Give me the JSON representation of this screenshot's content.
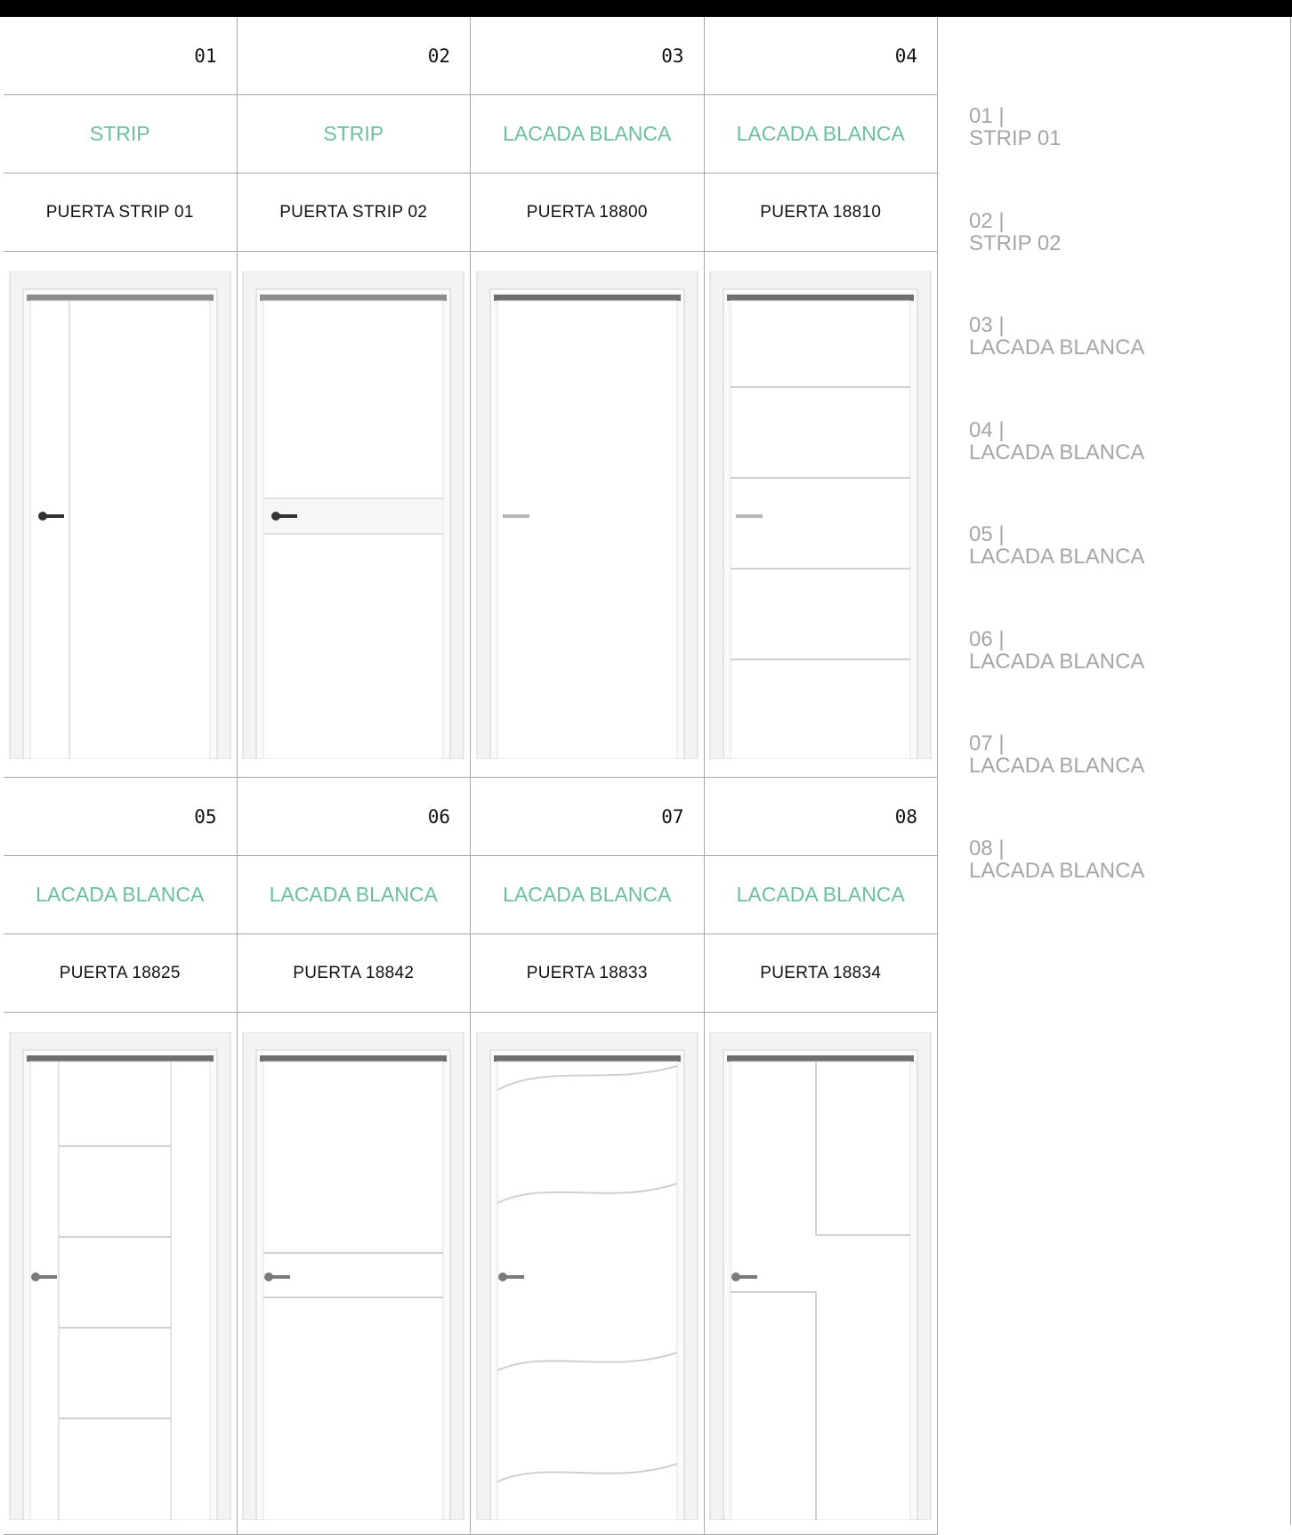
{
  "doors": [
    {
      "number": "01",
      "category": "STRIP",
      "name": "PUERTA STRIP 01",
      "icon": "door-strip-vertical-icon"
    },
    {
      "number": "02",
      "category": "STRIP",
      "name": "PUERTA STRIP 02",
      "icon": "door-strip-horizontal-icon"
    },
    {
      "number": "03",
      "category": "LACADA BLANCA",
      "name": "PUERTA 18800",
      "icon": "door-plain-icon"
    },
    {
      "number": "04",
      "category": "LACADA BLANCA",
      "name": "PUERTA 18810",
      "icon": "door-four-grooves-icon"
    },
    {
      "number": "05",
      "category": "LACADA BLANCA",
      "name": "PUERTA 18825",
      "icon": "door-ladder-grooves-icon"
    },
    {
      "number": "06",
      "category": "LACADA BLANCA",
      "name": "PUERTA 18842",
      "icon": "door-two-grooves-icon"
    },
    {
      "number": "07",
      "category": "LACADA BLANCA",
      "name": "PUERTA 18833",
      "icon": "door-wave-grooves-icon"
    },
    {
      "number": "08",
      "category": "LACADA BLANCA",
      "name": "PUERTA 18834",
      "icon": "door-offset-panels-icon"
    }
  ],
  "sidebar": [
    {
      "number": "01 |",
      "label": "STRIP 01"
    },
    {
      "number": "02 |",
      "label": "STRIP 02"
    },
    {
      "number": "03 |",
      "label": "LACADA BLANCA"
    },
    {
      "number": "04 |",
      "label": "LACADA BLANCA"
    },
    {
      "number": "05 |",
      "label": "LACADA BLANCA"
    },
    {
      "number": "06 |",
      "label": "LACADA BLANCA"
    },
    {
      "number": "07 |",
      "label": "LACADA BLANCA"
    },
    {
      "number": "08 |",
      "label": "LACADA BLANCA"
    }
  ],
  "colors": {
    "accent": "#6bbf9f",
    "sidebar_text": "#a6a6a6",
    "grid_line": "#a8a8a8",
    "top_bar": "#000000"
  }
}
